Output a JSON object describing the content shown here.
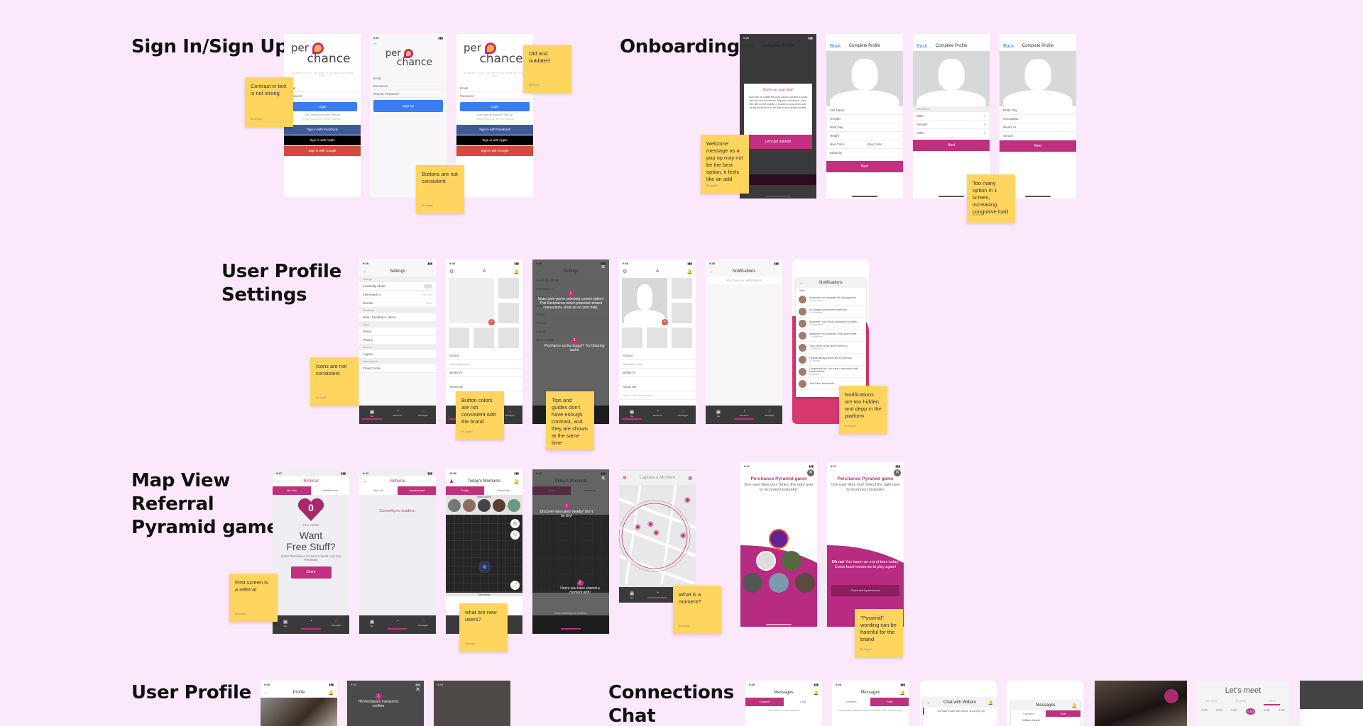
{
  "sections": {
    "signin": "Sign In/Sign Up",
    "onboarding": "Onboarding",
    "settings_line1": "User Profile",
    "settings_line2": "Settings",
    "map_line1": "Map View",
    "map_line2": "Referral",
    "map_line3": "Pyramid game",
    "profile": "User Profile",
    "chat_line1": "Connections",
    "chat_line2": "Chat"
  },
  "brand": {
    "logo_top": "per",
    "logo_bottom": "chance",
    "primary_color": "#c0307e",
    "login_blue": "#3b7cf2",
    "sticky_color": "#ffd55e",
    "canvas_bg": "#fce8fb"
  },
  "sticky_notes": [
    {
      "text": "Contrast in text is not strong",
      "author": "Bri Angelo"
    },
    {
      "text": "Buttons are not consistent",
      "author": "Bri Angelo"
    },
    {
      "text": "Old and outdated",
      "author": "Bri Angelo"
    },
    {
      "text": "Welcome message as a pop up may not be the best option, it feels like an add",
      "author": "Bri Angelo"
    },
    {
      "text": "Too many option in 1 screen, increasing congnitive load",
      "author": "Bri Angelo"
    },
    {
      "text": "Icons are not consistent",
      "author": "Bri Angelo"
    },
    {
      "text": "Button colors are not consistent with the brand",
      "author": "Bri Angelo"
    },
    {
      "text": "Tips and guides don't have enough contrast, and they are shown at the same time",
      "author": "Bri Angelo"
    },
    {
      "text": "Notifications are too hidden and depp in the platform",
      "author": "Bri Angelo"
    },
    {
      "text": "First screen is a referral",
      "author": "Bri Angelo"
    },
    {
      "text": "what are new users?",
      "author": "Bri Angelo"
    },
    {
      "text": "What is a moment?",
      "author": "Bri Angelo"
    },
    {
      "text": "\"Pyramid\" wording can be harmful for the brand",
      "author": "Bri Angelo"
    }
  ],
  "signin_screens": {
    "terms": "By tapping \"Log In\", you agree to our Terms and Privacy Policy",
    "email": "Email",
    "password": "Password",
    "repeat_password": "Repeat Password",
    "login": "Login",
    "signup": "Sign Up",
    "no_account": "Don't have an account? Sign Up",
    "forgot": "Forgot password? Reset Password",
    "facebook": "Sign in with Facebook",
    "apple": "Sign in with Apple",
    "google": "Sign in with Google",
    "time": "8:37"
  },
  "onboarding_screens": {
    "time": "9:38",
    "back": "Back",
    "title": "Complete Profile",
    "popup_title": "You're on your way!",
    "popup_body": "Now tell us a little bit more about yourself so that we can do our best to help you reconnect. Your info will not be public or shown to any other user at any point and is not part of your public profile.",
    "popup_cta": "Let's get started!",
    "fields_a": [
      "Full Name",
      "Gender",
      "Birth Day",
      "Height",
      "Hair Color",
      "Ethnicity"
    ],
    "eye_color": "Eye Color",
    "interested_in": "Interested in",
    "options": [
      "Male",
      "Female",
      "Other"
    ],
    "fields_c": [
      "Enter City",
      "Occupation",
      "Works At",
      "School"
    ],
    "next": "Next"
  },
  "settings_screens": {
    "time": "9:45",
    "title": "Settings",
    "groups": {
      "settings": "Settings",
      "feedback": "Feedback",
      "legal": "Legal",
      "account": "Account",
      "development": "Development"
    },
    "rows": {
      "invisibility": "Invisibility Mode",
      "interested": "Interested In",
      "interested_val": "Female",
      "gender": "Gender",
      "gender_val": "Male",
      "help": "Help / Feedback / More",
      "terms": "Terms",
      "privacy": "Privacy",
      "logout": "Logout",
      "clear_cache": "Clear Cache"
    },
    "profile_initial": "A",
    "school": "School",
    "school_val": "University of Iowa",
    "works_at": "Works At",
    "about_me": "About Me",
    "about_placeholder": "Tell us a little about yourself",
    "tip1": "Make sure you're selecting correct option! This Determines which potential missed connections show up on your map.",
    "tip2": "Perchance acting buggy? Try Clearing cache",
    "notifications_title": "Notifications",
    "no_notifications": "You have no notifications",
    "older": "Older",
    "notifications": [
      {
        "text": "Awesome! You accepted Hu Guiying invite.",
        "date": "5 November"
      },
      {
        "text": "Hu Guiying would like to meet you.",
        "date": "5 November"
      },
      {
        "text": "Awesome! John Wood accepted your invite.",
        "date": "1 November"
      },
      {
        "text": "Awesome! You accepted Tony Green invite.",
        "date": "1 November"
      },
      {
        "text": "Tony Green would like to meet you.",
        "date": "1 November"
      },
      {
        "text": "Farhaan Bhaiya would like to meet you.",
        "date": "8 October"
      },
      {
        "text": "Congratulations! You have a new match with Martin Abasto",
        "date": "3 October"
      },
      {
        "text": "Jack Dillon has shared...",
        "date": ""
      }
    ],
    "tabs": [
      "Me",
      "Moments",
      "Messages"
    ]
  },
  "map_screens": {
    "referral_title": "Referral",
    "my_link": "My Link",
    "leaderboard": "Leaderboard",
    "hearts_count": "0",
    "your_hearts": "Your Hearts",
    "want": "Want",
    "free_stuff": "Free Stuff?",
    "refer_text": "Refer Perchance To Your Friends And Get Rewards!",
    "share": "Share",
    "no_leaders": "Currently no leaders.",
    "moments_title": "Today's Moments",
    "today": "Today",
    "yesterday": "Yesterday",
    "new_users": "New Users",
    "moments": "Moments",
    "tip_new_users": "Discover new users nearby! Don't be shy!",
    "tip_shared": "Users you have shared a moment with!",
    "keep_searching": "Keep searching for moments",
    "capture_title": "Capture a Moment",
    "pyramid_title": "Perchance Pyramid game",
    "pyramid_sub": "One user likes you! Select the right user to reconnect instantly!",
    "oh_no": "Oh no!",
    "out_of_tries": "You have run out of tries today. Come back tomorrow to play again!",
    "close_try": "Close and try tomorrow",
    "time1": "9:47",
    "time2": "10:50"
  },
  "profile_screens": {
    "title": "Profile",
    "tip": "Hit Perchance moment to confirm",
    "time": "9:45"
  },
  "chat_screens": {
    "messages": "Messages",
    "connect": "Connect",
    "chat": "Chat",
    "no_connections": "You have no connections",
    "no_conversation": "You haven't started a conversation with anyone yet.",
    "chat_with": "Chat with William",
    "date_msg": "You have a date with Dina in 11/18 4:12 pm",
    "contact": "William Dwedi",
    "lets_meet": "Let's meet",
    "durations": [
      "15 mins",
      "30 mins",
      "Other"
    ],
    "times": [
      "4:30",
      "5:00",
      "5:30",
      "6:00",
      "6:30",
      "7:00"
    ],
    "time": "9:48"
  }
}
